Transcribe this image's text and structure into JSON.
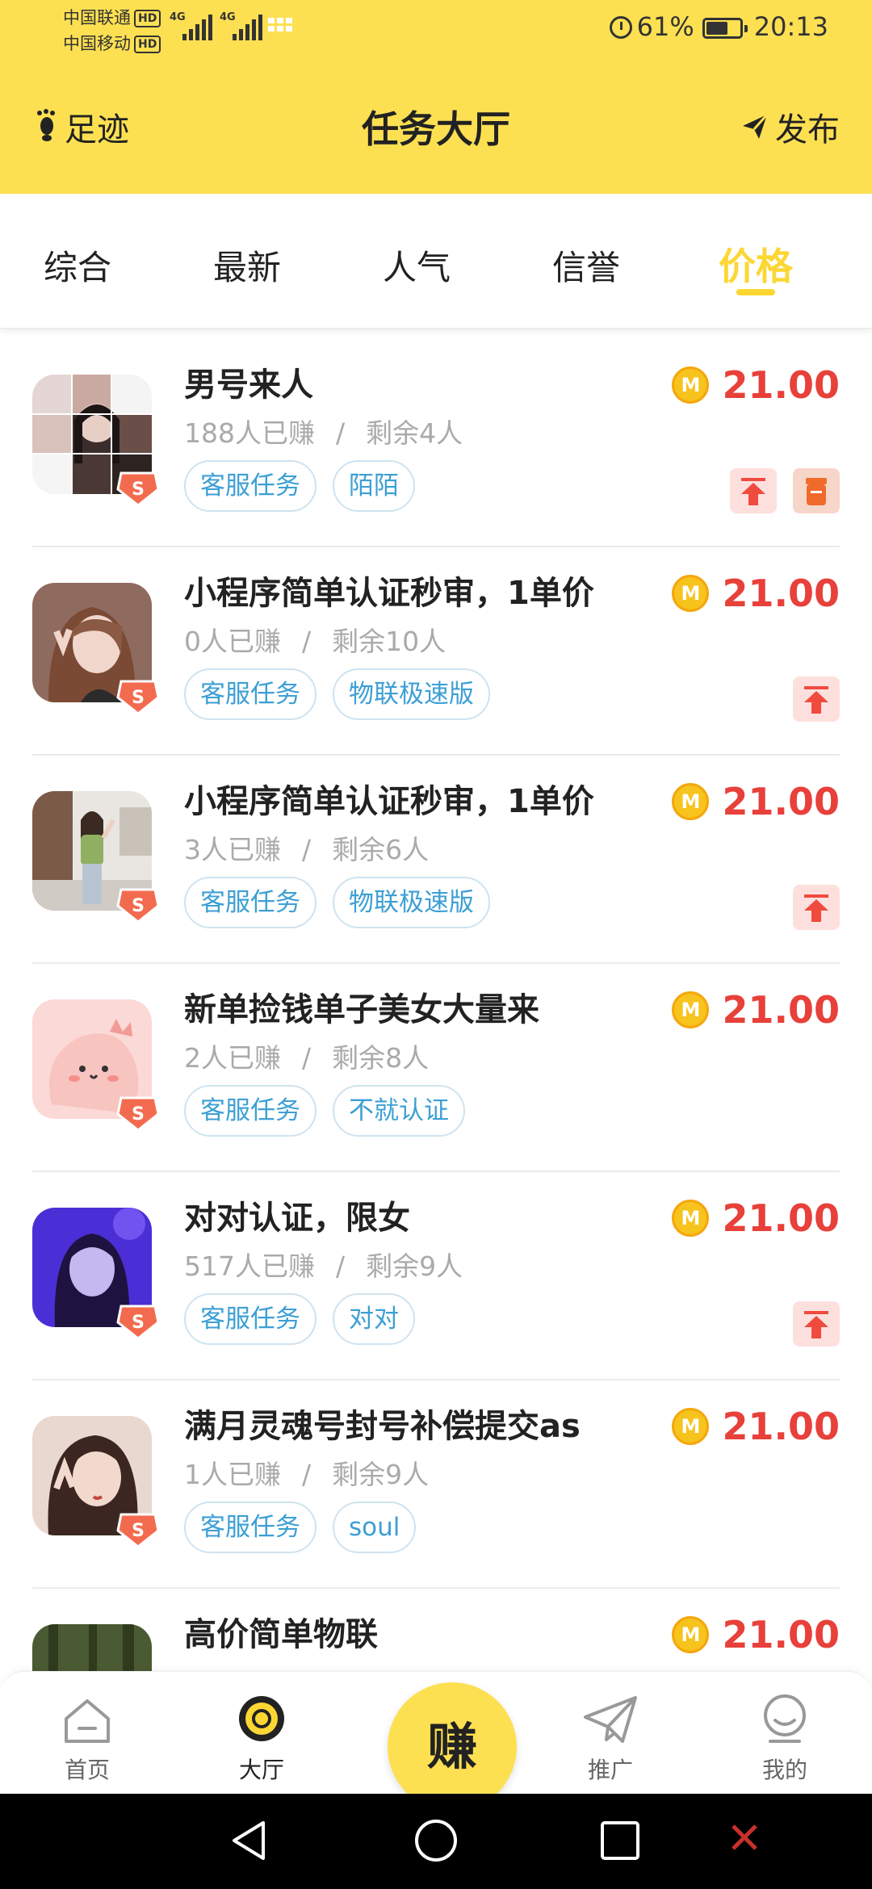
{
  "status_bar": {
    "carrier1": "中国联通",
    "carrier2": "中国移动",
    "hd": "HD",
    "net1": "4G",
    "net2": "4G",
    "battery": "61%",
    "time": "20:13"
  },
  "header": {
    "left_label": "足迹",
    "title": "任务大厅",
    "right_label": "发布"
  },
  "tabs": [
    {
      "label": "综合",
      "active": false
    },
    {
      "label": "最新",
      "active": false
    },
    {
      "label": "人气",
      "active": false
    },
    {
      "label": "信誉",
      "active": false
    },
    {
      "label": "价格",
      "active": true
    }
  ],
  "items": [
    {
      "title": "男号来人",
      "earned": "188人已赚",
      "sep": "/",
      "remaining": "剩余4人",
      "tags": [
        "客服任务",
        "陌陌"
      ],
      "coin": "M",
      "price": "21.00",
      "icons": [
        "top-icon",
        "bag-icon"
      ]
    },
    {
      "title": "小程序简单认证秒审，1单价",
      "earned": "0人已赚",
      "sep": "/",
      "remaining": "剩余10人",
      "tags": [
        "客服任务",
        "物联极速版"
      ],
      "coin": "M",
      "price": "21.00",
      "icons": [
        "top-icon"
      ]
    },
    {
      "title": "小程序简单认证秒审，1单价",
      "earned": "3人已赚",
      "sep": "/",
      "remaining": "剩余6人",
      "tags": [
        "客服任务",
        "物联极速版"
      ],
      "coin": "M",
      "price": "21.00",
      "icons": [
        "top-icon"
      ]
    },
    {
      "title": "新单捡钱单子美女大量来",
      "earned": "2人已赚",
      "sep": "/",
      "remaining": "剩余8人",
      "tags": [
        "客服任务",
        "不就认证"
      ],
      "coin": "M",
      "price": "21.00",
      "icons": []
    },
    {
      "title": "对对认证，限女",
      "earned": "517人已赚",
      "sep": "/",
      "remaining": "剩余9人",
      "tags": [
        "客服任务",
        "对对"
      ],
      "coin": "M",
      "price": "21.00",
      "icons": [
        "top-icon"
      ]
    },
    {
      "title": "满月灵魂号封号补偿提交as",
      "earned": "1人已赚",
      "sep": "/",
      "remaining": "剩余9人",
      "tags": [
        "客服任务",
        "soul"
      ],
      "coin": "M",
      "price": "21.00",
      "icons": []
    },
    {
      "title": "高价简单物联",
      "earned": "",
      "sep": "",
      "remaining": "",
      "tags": [],
      "coin": "M",
      "price": "21.00",
      "icons": []
    }
  ],
  "bottom_nav": [
    {
      "label": "首页",
      "icon": "home-icon",
      "active": false
    },
    {
      "label": "大厅",
      "icon": "hall-icon",
      "active": true
    },
    {
      "label": "推广",
      "icon": "paper-plane-icon",
      "active": false
    },
    {
      "label": "我的",
      "icon": "profile-icon",
      "active": false
    }
  ],
  "earn_button": "赚",
  "colors": {
    "header_bg": "#fde052",
    "accent": "#fcd733",
    "price": "#e8403a",
    "tag_text": "#3c9fd4"
  }
}
